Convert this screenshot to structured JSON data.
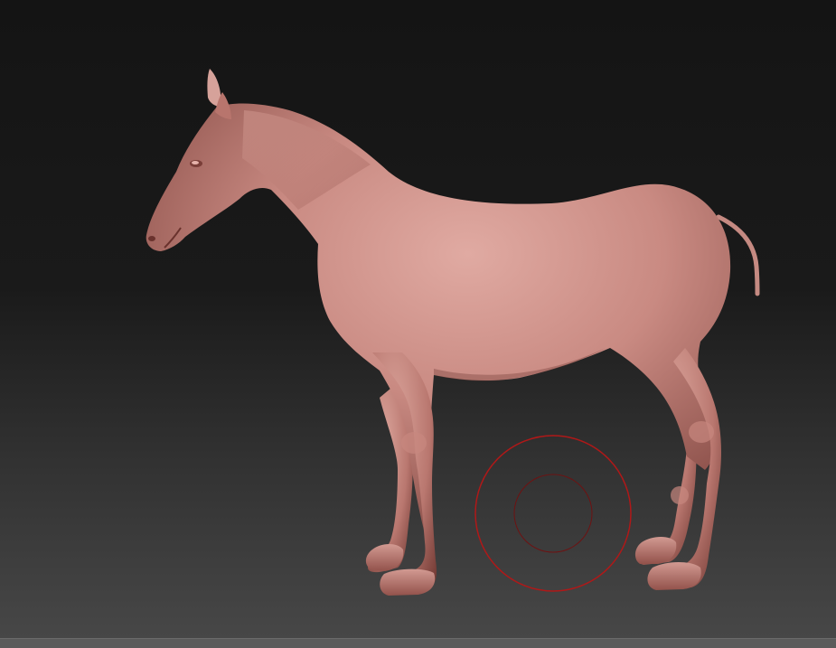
{
  "viewport": {
    "background_top": "#141414",
    "background_bottom": "#474747"
  },
  "model": {
    "subject": "horse",
    "material_color": "#c98a82",
    "shadow_color": "#8a4a44"
  },
  "brush_cursor": {
    "color": "#b01818"
  },
  "status_bar": {
    "color": "#5b5b5b"
  }
}
